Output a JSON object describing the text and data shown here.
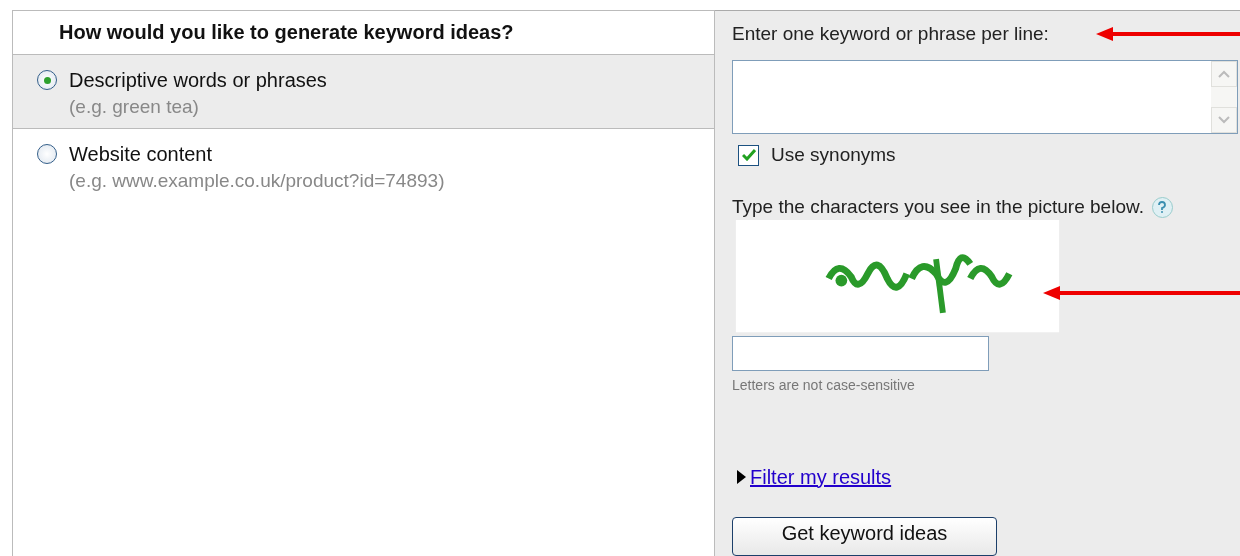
{
  "section_title": "How would you like to generate keyword ideas?",
  "options": [
    {
      "label": "Descriptive words or phrases",
      "hint": "(e.g. green tea)",
      "selected": true
    },
    {
      "label": "Website content",
      "hint": "(e.g. www.example.co.uk/product?id=74893)",
      "selected": false
    }
  ],
  "keyword_field": {
    "label": "Enter one keyword or phrase per line:"
  },
  "synonyms": {
    "label": "Use synonyms",
    "checked": true
  },
  "captcha": {
    "prompt": "Type the characters you see in the picture below.",
    "note": "Letters are not case-sensitive"
  },
  "filter_link": "Filter my results",
  "submit_button": "Get keyword ideas"
}
